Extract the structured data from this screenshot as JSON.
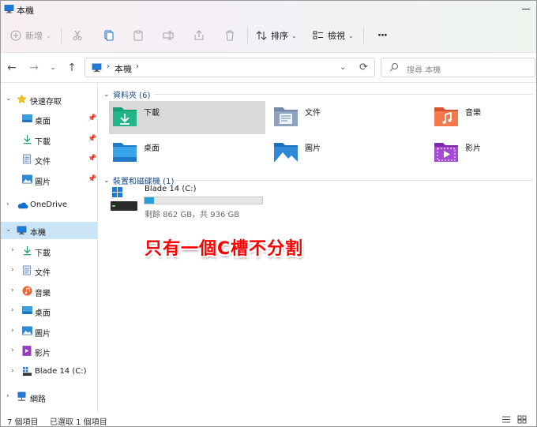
{
  "window": {
    "title": "本機"
  },
  "toolbar": {
    "new_label": "新增",
    "sort_label": "排序",
    "view_label": "檢視",
    "more_label": "···"
  },
  "address": {
    "crumb": "本機"
  },
  "search": {
    "placeholder": "搜尋 本機"
  },
  "nav": {
    "quick_access": "快速存取",
    "quick_items": [
      {
        "label": "桌面",
        "icon": "desktop-icon"
      },
      {
        "label": "下載",
        "icon": "download-icon"
      },
      {
        "label": "文件",
        "icon": "document-icon"
      },
      {
        "label": "圖片",
        "icon": "picture-icon"
      }
    ],
    "onedrive": "OneDrive",
    "thispc": "本機",
    "thispc_items": [
      {
        "label": "下載",
        "icon": "download-icon"
      },
      {
        "label": "文件",
        "icon": "document-icon"
      },
      {
        "label": "音樂",
        "icon": "music-icon"
      },
      {
        "label": "桌面",
        "icon": "desktop-icon"
      },
      {
        "label": "圖片",
        "icon": "picture-icon"
      },
      {
        "label": "影片",
        "icon": "video-icon"
      },
      {
        "label": "Blade 14 (C:)",
        "icon": "drive-icon"
      }
    ],
    "network": "網路"
  },
  "content": {
    "folders_header": "資料夾 (6)",
    "folders": [
      {
        "name": "下載",
        "icon": "download-folder-icon"
      },
      {
        "name": "文件",
        "icon": "documents-folder-icon"
      },
      {
        "name": "音樂",
        "icon": "music-folder-icon"
      },
      {
        "name": "桌面",
        "icon": "desktop-folder-icon"
      },
      {
        "name": "圖片",
        "icon": "pictures-folder-icon"
      },
      {
        "name": "影片",
        "icon": "videos-folder-icon"
      }
    ],
    "drives_header": "裝置和磁碟機 (1)",
    "drive": {
      "name": "Blade 14 (C:)",
      "free_text": "剩餘 862 GB，共 936 GB",
      "used_fraction": 0.08
    },
    "annotation": "只有一個C槽不分割"
  },
  "status": {
    "items": "7 個項目",
    "selected": "已選取 1 個項目"
  },
  "colors": {
    "accent": "#0067c0",
    "selection": "#cce4f7",
    "tile_selected": "#d9d9d9",
    "annotation": "#ff0000",
    "drive_fill": "#26a0da"
  }
}
